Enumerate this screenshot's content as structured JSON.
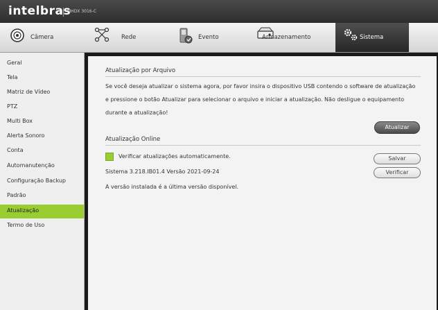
{
  "header": {
    "brand": "intelbras",
    "model": "MHDX 3016-C"
  },
  "tabs": [
    {
      "label": "Câmera",
      "icon": "camera-icon"
    },
    {
      "label": "Rede",
      "icon": "network-icon"
    },
    {
      "label": "Evento",
      "icon": "event-icon"
    },
    {
      "label": "Armazenamento",
      "icon": "storage-icon"
    },
    {
      "label": "Sistema",
      "icon": "system-gears-icon",
      "active": true
    }
  ],
  "sidebar": {
    "items": [
      {
        "label": "Geral"
      },
      {
        "label": "Tela"
      },
      {
        "label": "Matriz de Vídeo"
      },
      {
        "label": "PTZ"
      },
      {
        "label": "Multi Box"
      },
      {
        "label": "Alerta Sonoro"
      },
      {
        "label": "Conta"
      },
      {
        "label": "Automanutenção"
      },
      {
        "label": "Configuração Backup"
      },
      {
        "label": "Padrão"
      },
      {
        "label": "Atualização",
        "active": true
      },
      {
        "label": "Termo de Uso"
      }
    ],
    "active_color": "#9acd32"
  },
  "file_update": {
    "title": "Atualização por Arquivo",
    "line1": "Se você deseja atualizar o sistema agora, por favor insira o dispositivo USB contendo o software de atualização",
    "line2": "e pressione o botão Atualizar para selecionar o arquivo e iniciar a atualização. Não desligue o equipamento",
    "line3": "durante a atualização!",
    "button": "Atualizar"
  },
  "online_update": {
    "title": "Atualização Online",
    "auto_check_label": "Verificar atualizações automaticamente.",
    "auto_check_checked": true,
    "save_button": "Salvar",
    "system_version": "Sistema  3.218.IB01.4 Versão  2021-09-24",
    "verify_button": "Verificar",
    "status": "A versão instalada é a última versão disponível."
  }
}
